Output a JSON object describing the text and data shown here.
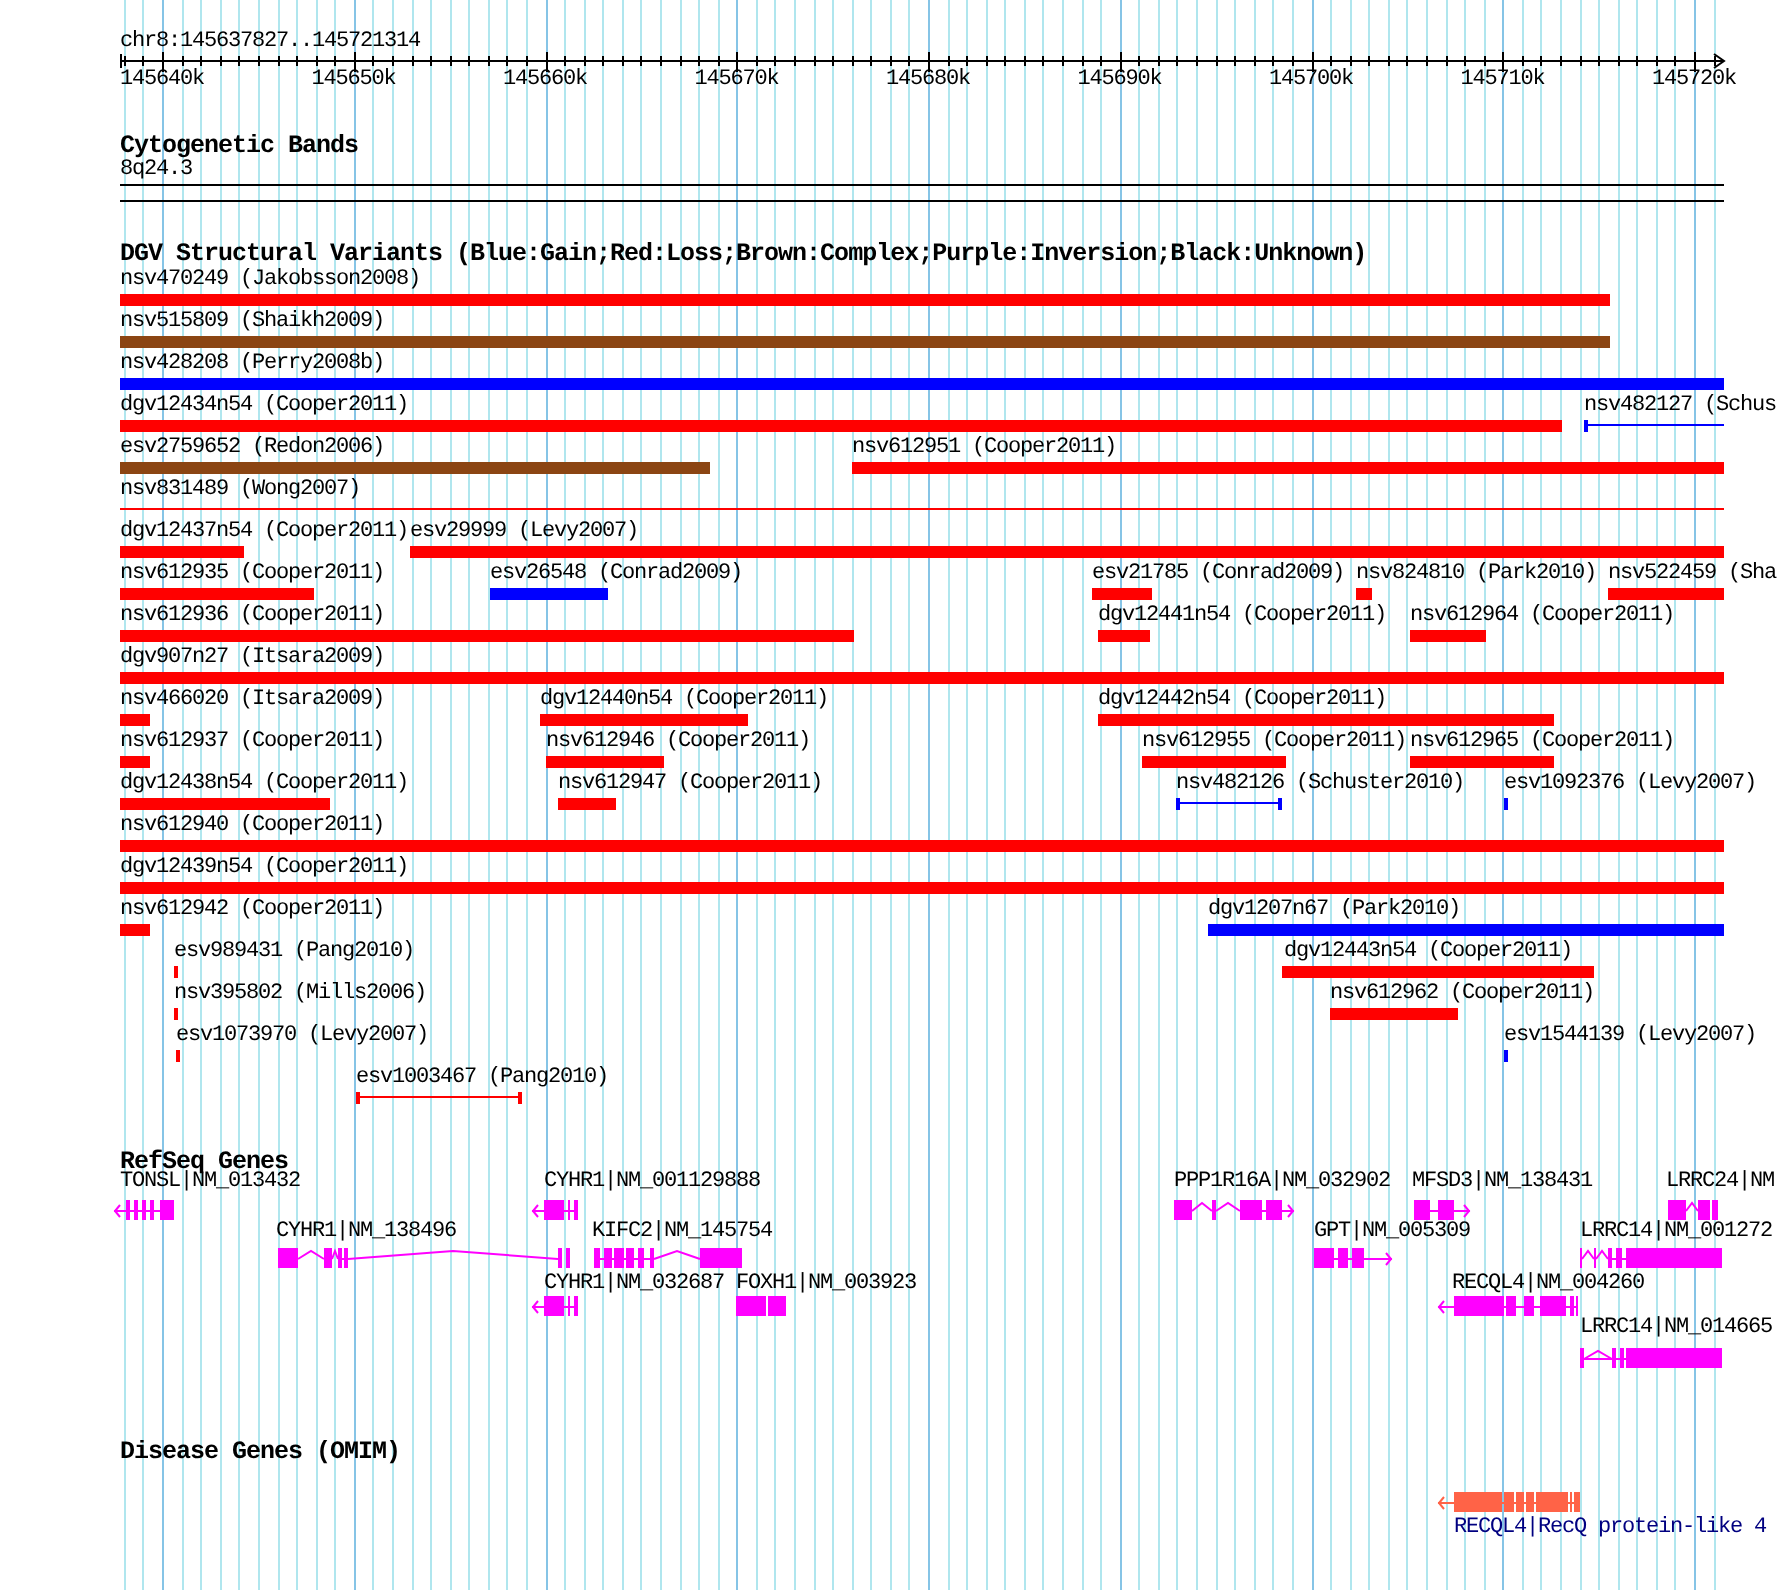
{
  "ruler": {
    "position": "chr8:145637827..145721314",
    "ticks": [
      "145640k",
      "145650k",
      "145660k",
      "145670k",
      "145680k",
      "145690k",
      "145700k",
      "145710k",
      "145720k"
    ]
  },
  "cytogenetic_bands": {
    "title": "Cytogenetic Bands",
    "bands": [
      {
        "label": "8q24.3"
      }
    ]
  },
  "dgv_structural_variants": {
    "title": "DGV Structural Variants (Blue:Gain;Red:Loss;Brown:Complex;Purple:Inversion;Black:Unknown)",
    "rows": [
      {
        "features": [
          {
            "label": "nsv470249 (Jakobsson2008)",
            "color": "#ff0000",
            "kind": "thick"
          }
        ]
      },
      {
        "features": [
          {
            "label": "nsv515809 (Shaikh2009)",
            "color": "#8b4513",
            "kind": "thick"
          }
        ]
      },
      {
        "features": [
          {
            "label": "nsv428208 (Perry2008b)",
            "color": "#0000ff",
            "kind": "thick"
          }
        ]
      },
      {
        "features": [
          {
            "label": "dgv12434n54 (Cooper2011)",
            "color": "#ff0000",
            "kind": "thick"
          },
          {
            "label": "nsv482127 (Schus",
            "color": "#0000ff",
            "kind": "thin"
          }
        ]
      },
      {
        "features": [
          {
            "label": "esv2759652 (Redon2006)",
            "color": "#8b4513",
            "kind": "thick"
          },
          {
            "label": "nsv612951 (Cooper2011)",
            "color": "#ff0000",
            "kind": "thick"
          }
        ]
      },
      {
        "features": [
          {
            "label": "nsv831489 (Wong2007)",
            "color": "#ff0000",
            "kind": "thin"
          }
        ]
      },
      {
        "features": [
          {
            "label": "dgv12437n54 (Cooper2011)",
            "color": "#ff0000",
            "kind": "thick"
          },
          {
            "label": "esv29999 (Levy2007)",
            "color": "#ff0000",
            "kind": "thick"
          }
        ]
      },
      {
        "features": [
          {
            "label": "nsv612935 (Cooper2011)",
            "color": "#ff0000",
            "kind": "thick"
          },
          {
            "label": "esv26548 (Conrad2009)",
            "color": "#0000ff",
            "kind": "thick"
          },
          {
            "label": "esv21785 (Conrad2009)",
            "color": "#ff0000",
            "kind": "thick"
          },
          {
            "label": "nsv824810 (Park2010)",
            "color": "#ff0000",
            "kind": "thick"
          },
          {
            "label": "nsv522459 (Sha",
            "color": "#ff0000",
            "kind": "thick"
          }
        ]
      },
      {
        "features": [
          {
            "label": "nsv612936 (Cooper2011)",
            "color": "#ff0000",
            "kind": "thick"
          },
          {
            "label": "dgv12441n54 (Cooper2011)",
            "color": "#ff0000",
            "kind": "thick"
          },
          {
            "label": "nsv612964 (Cooper2011)",
            "color": "#ff0000",
            "kind": "thick"
          }
        ]
      },
      {
        "features": [
          {
            "label": "dgv907n27 (Itsara2009)",
            "color": "#ff0000",
            "kind": "thick"
          }
        ]
      },
      {
        "features": [
          {
            "label": "nsv466020 (Itsara2009)",
            "color": "#ff0000",
            "kind": "thick"
          },
          {
            "label": "dgv12440n54 (Cooper2011)",
            "color": "#ff0000",
            "kind": "thick"
          },
          {
            "label": "dgv12442n54 (Cooper2011)",
            "color": "#ff0000",
            "kind": "thick"
          }
        ]
      },
      {
        "features": [
          {
            "label": "nsv612937 (Cooper2011)",
            "color": "#ff0000",
            "kind": "thick"
          },
          {
            "label": "nsv612946 (Cooper2011)",
            "color": "#ff0000",
            "kind": "thick"
          },
          {
            "label": "nsv612955 (Cooper2011)",
            "color": "#ff0000",
            "kind": "thick"
          },
          {
            "label": "nsv612965 (Cooper2011)",
            "color": "#ff0000",
            "kind": "thick"
          }
        ]
      },
      {
        "features": [
          {
            "label": "dgv12438n54 (Cooper2011)",
            "color": "#ff0000",
            "kind": "thick"
          },
          {
            "label": "nsv612947 (Cooper2011)",
            "color": "#ff0000",
            "kind": "thick"
          },
          {
            "label": "nsv482126 (Schuster2010)",
            "color": "#0000ff",
            "kind": "thin"
          },
          {
            "label": "esv1092376 (Levy2007)",
            "color": "#0000ff",
            "kind": "thick"
          }
        ]
      },
      {
        "features": [
          {
            "label": "nsv612940 (Cooper2011)",
            "color": "#ff0000",
            "kind": "thick"
          }
        ]
      },
      {
        "features": [
          {
            "label": "dgv12439n54 (Cooper2011)",
            "color": "#ff0000",
            "kind": "thick"
          }
        ]
      },
      {
        "features": [
          {
            "label": "nsv612942 (Cooper2011)",
            "color": "#ff0000",
            "kind": "thick"
          },
          {
            "label": "dgv1207n67 (Park2010)",
            "color": "#0000ff",
            "kind": "thick"
          }
        ]
      },
      {
        "features": [
          {
            "label": "esv989431 (Pang2010)",
            "color": "#ff0000",
            "kind": "thick"
          },
          {
            "label": "dgv12443n54 (Cooper2011)",
            "color": "#ff0000",
            "kind": "thick"
          }
        ]
      },
      {
        "features": [
          {
            "label": "nsv395802 (Mills2006)",
            "color": "#ff0000",
            "kind": "thick"
          },
          {
            "label": "nsv612962 (Cooper2011)",
            "color": "#ff0000",
            "kind": "thick"
          }
        ]
      },
      {
        "features": [
          {
            "label": "esv1073970 (Levy2007)",
            "color": "#ff0000",
            "kind": "thick"
          },
          {
            "label": "esv1544139 (Levy2007)",
            "color": "#0000ff",
            "kind": "thick"
          }
        ]
      },
      {
        "features": [
          {
            "label": "esv1003467 (Pang2010)",
            "color": "#ff0000",
            "kind": "thin"
          }
        ]
      }
    ]
  },
  "refseq_genes": {
    "title": "RefSeq Genes",
    "rows": [
      {
        "genes": [
          {
            "label": "TONSL|NM_013432",
            "kind": "minus"
          },
          {
            "label": "CYHR1|NM_001129888",
            "kind": "minus"
          },
          {
            "label": "PPP1R16A|NM_032902",
            "kind": "plus"
          },
          {
            "label": "MFSD3|NM_138431",
            "kind": "plus"
          },
          {
            "label": "LRRC24|NM",
            "kind": "plain"
          }
        ]
      },
      {
        "genes": [
          {
            "label": "CYHR1|NM_138496",
            "kind": "plain"
          },
          {
            "label": "KIFC2|NM_145754",
            "kind": "plain"
          },
          {
            "label": "GPT|NM_005309",
            "kind": "plus"
          },
          {
            "label": "LRRC14|NM_001272",
            "kind": "plain"
          }
        ]
      },
      {
        "genes": [
          {
            "label": "CYHR1|NM_032687",
            "kind": "minus"
          },
          {
            "label": "FOXH1|NM_003923",
            "kind": "plain"
          },
          {
            "label": "RECQL4|NM_004260",
            "kind": "minus"
          }
        ]
      },
      {
        "genes": [
          {
            "label": "LRRC14|NM_014665",
            "kind": "plain"
          }
        ]
      }
    ]
  },
  "disease_genes": {
    "title": "Disease Genes (OMIM)",
    "genes": [
      {
        "label": "RECQL4|RecQ protein-like 4",
        "kind": "minus"
      }
    ]
  }
}
